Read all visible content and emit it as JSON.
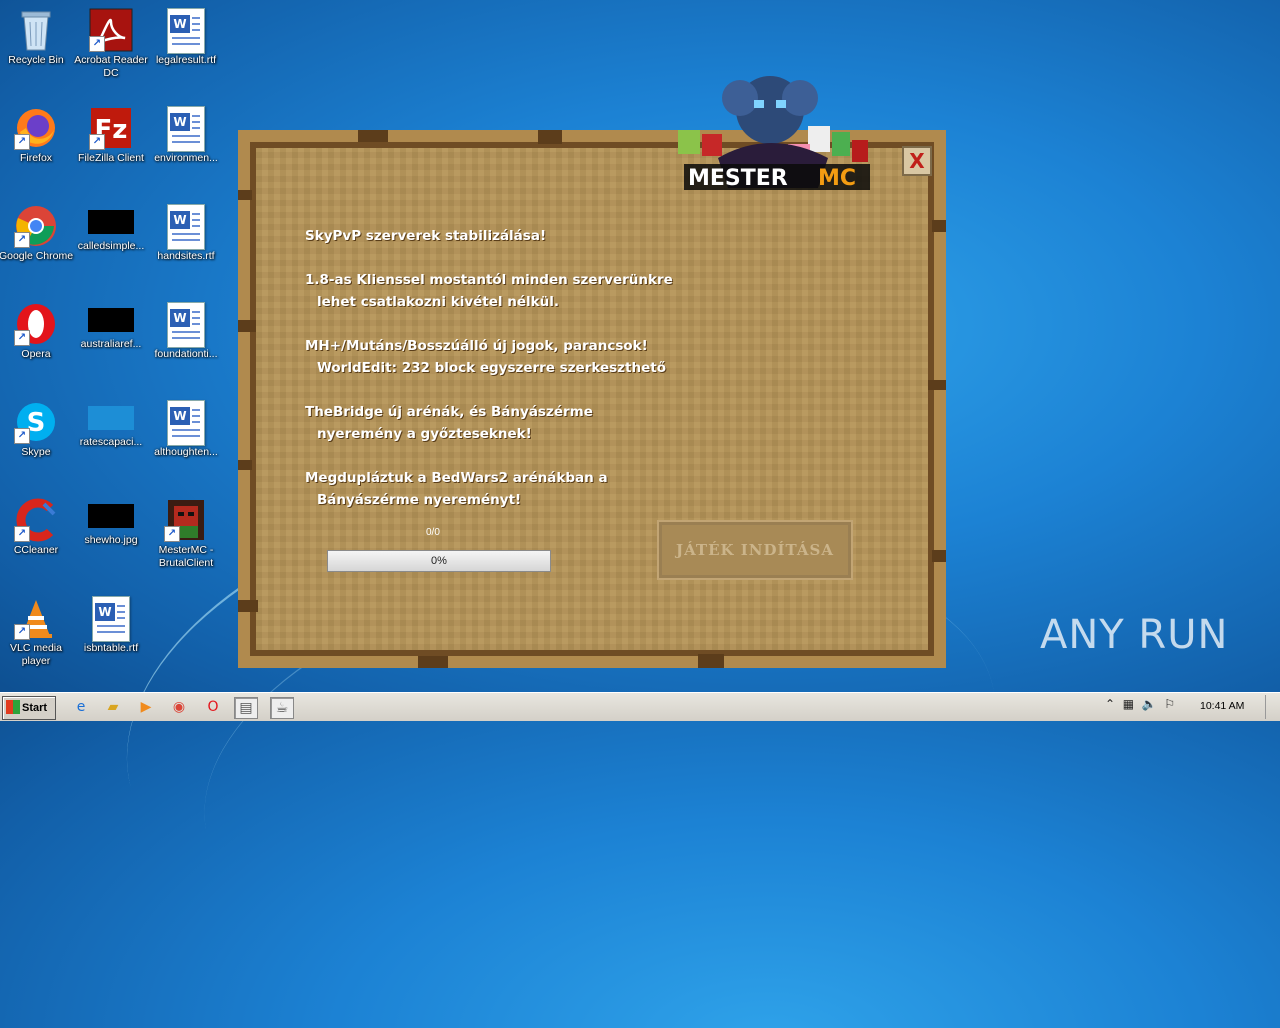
{
  "desktop": {
    "icons": [
      {
        "label": "Recycle Bin"
      },
      {
        "label": "Acrobat Reader DC"
      },
      {
        "label": "legalresult.rtf"
      },
      {
        "label": "Firefox"
      },
      {
        "label": "FileZilla Client"
      },
      {
        "label": "environmen..."
      },
      {
        "label": "Google Chrome"
      },
      {
        "label": "calledsimple..."
      },
      {
        "label": "handsites.rtf"
      },
      {
        "label": "Opera"
      },
      {
        "label": "australiaref..."
      },
      {
        "label": "foundationti..."
      },
      {
        "label": "Skype"
      },
      {
        "label": "ratescapaci..."
      },
      {
        "label": "althoughten..."
      },
      {
        "label": "CCleaner"
      },
      {
        "label": "shewho.jpg"
      },
      {
        "label": "MesterMC - BrutalClient"
      },
      {
        "label": "VLC media player"
      },
      {
        "label": "isbntable.rtf"
      }
    ]
  },
  "launcher": {
    "close_label": "X",
    "logo_text": "MESTERMC",
    "news": [
      {
        "line1": "SkyPvP szerverek stabilizálása!",
        "line2": ""
      },
      {
        "line1": "1.8-as Klienssel mostantól minden szerverünkre",
        "line2": "lehet csatlakozni kivétel nélkül."
      },
      {
        "line1": "MH+/Mutáns/Bosszúálló új jogok, parancsok!",
        "line2": "WorldEdit: 232 block egyszerre szerkeszthető"
      },
      {
        "line1": "TheBridge új arénák, és Bányászérme",
        "line2": "nyeremény a győzteseknek!"
      },
      {
        "line1": "Megdupláztuk a BedWars2 arénákban a",
        "line2": "Bányászérme nyereményt!"
      }
    ],
    "download_counter": "0/0",
    "progress_text": "0%",
    "progress_value": 0,
    "start_button": "JÁTÉK INDÍTÁSA"
  },
  "watermark": "ANY RUN",
  "taskbar": {
    "start_label": "Start",
    "clock": "10:41 AM"
  }
}
